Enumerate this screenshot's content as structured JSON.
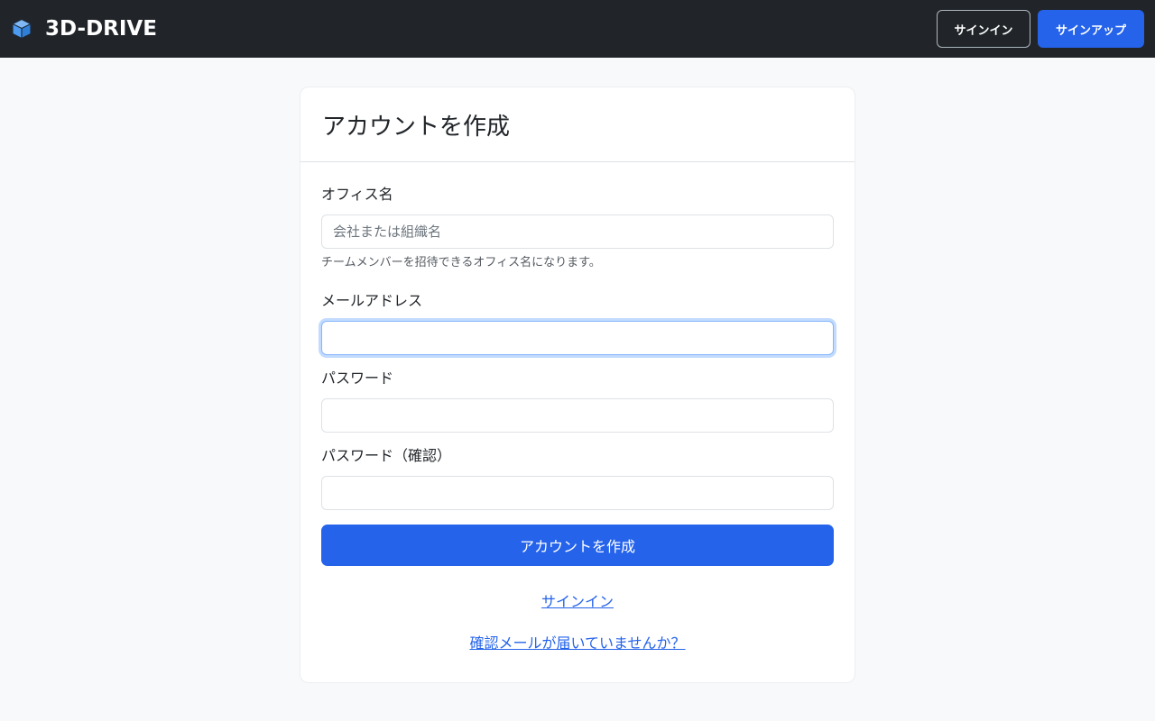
{
  "header": {
    "brand": "3D-DRIVE",
    "brand_icon": "cube-icon",
    "signin_label": "サインイン",
    "signup_label": "サインアップ"
  },
  "form": {
    "title": "アカウントを作成",
    "office_label": "オフィス名",
    "office_placeholder": "会社または組織名",
    "office_help": "チームメンバーを招待できるオフィス名になります。",
    "email_label": "メールアドレス",
    "email_value": "",
    "password_label": "パスワード",
    "password_value": "",
    "confirm_label": "パスワード（確認）",
    "confirm_value": "",
    "submit_label": "アカウントを作成",
    "signin_link": "サインイン",
    "resend_link": "確認メールが届いていませんか？"
  },
  "colors": {
    "navbar": "#212529",
    "primary": "#2563eb",
    "background": "#f8f9fa",
    "icon": "#4d9bf0"
  }
}
